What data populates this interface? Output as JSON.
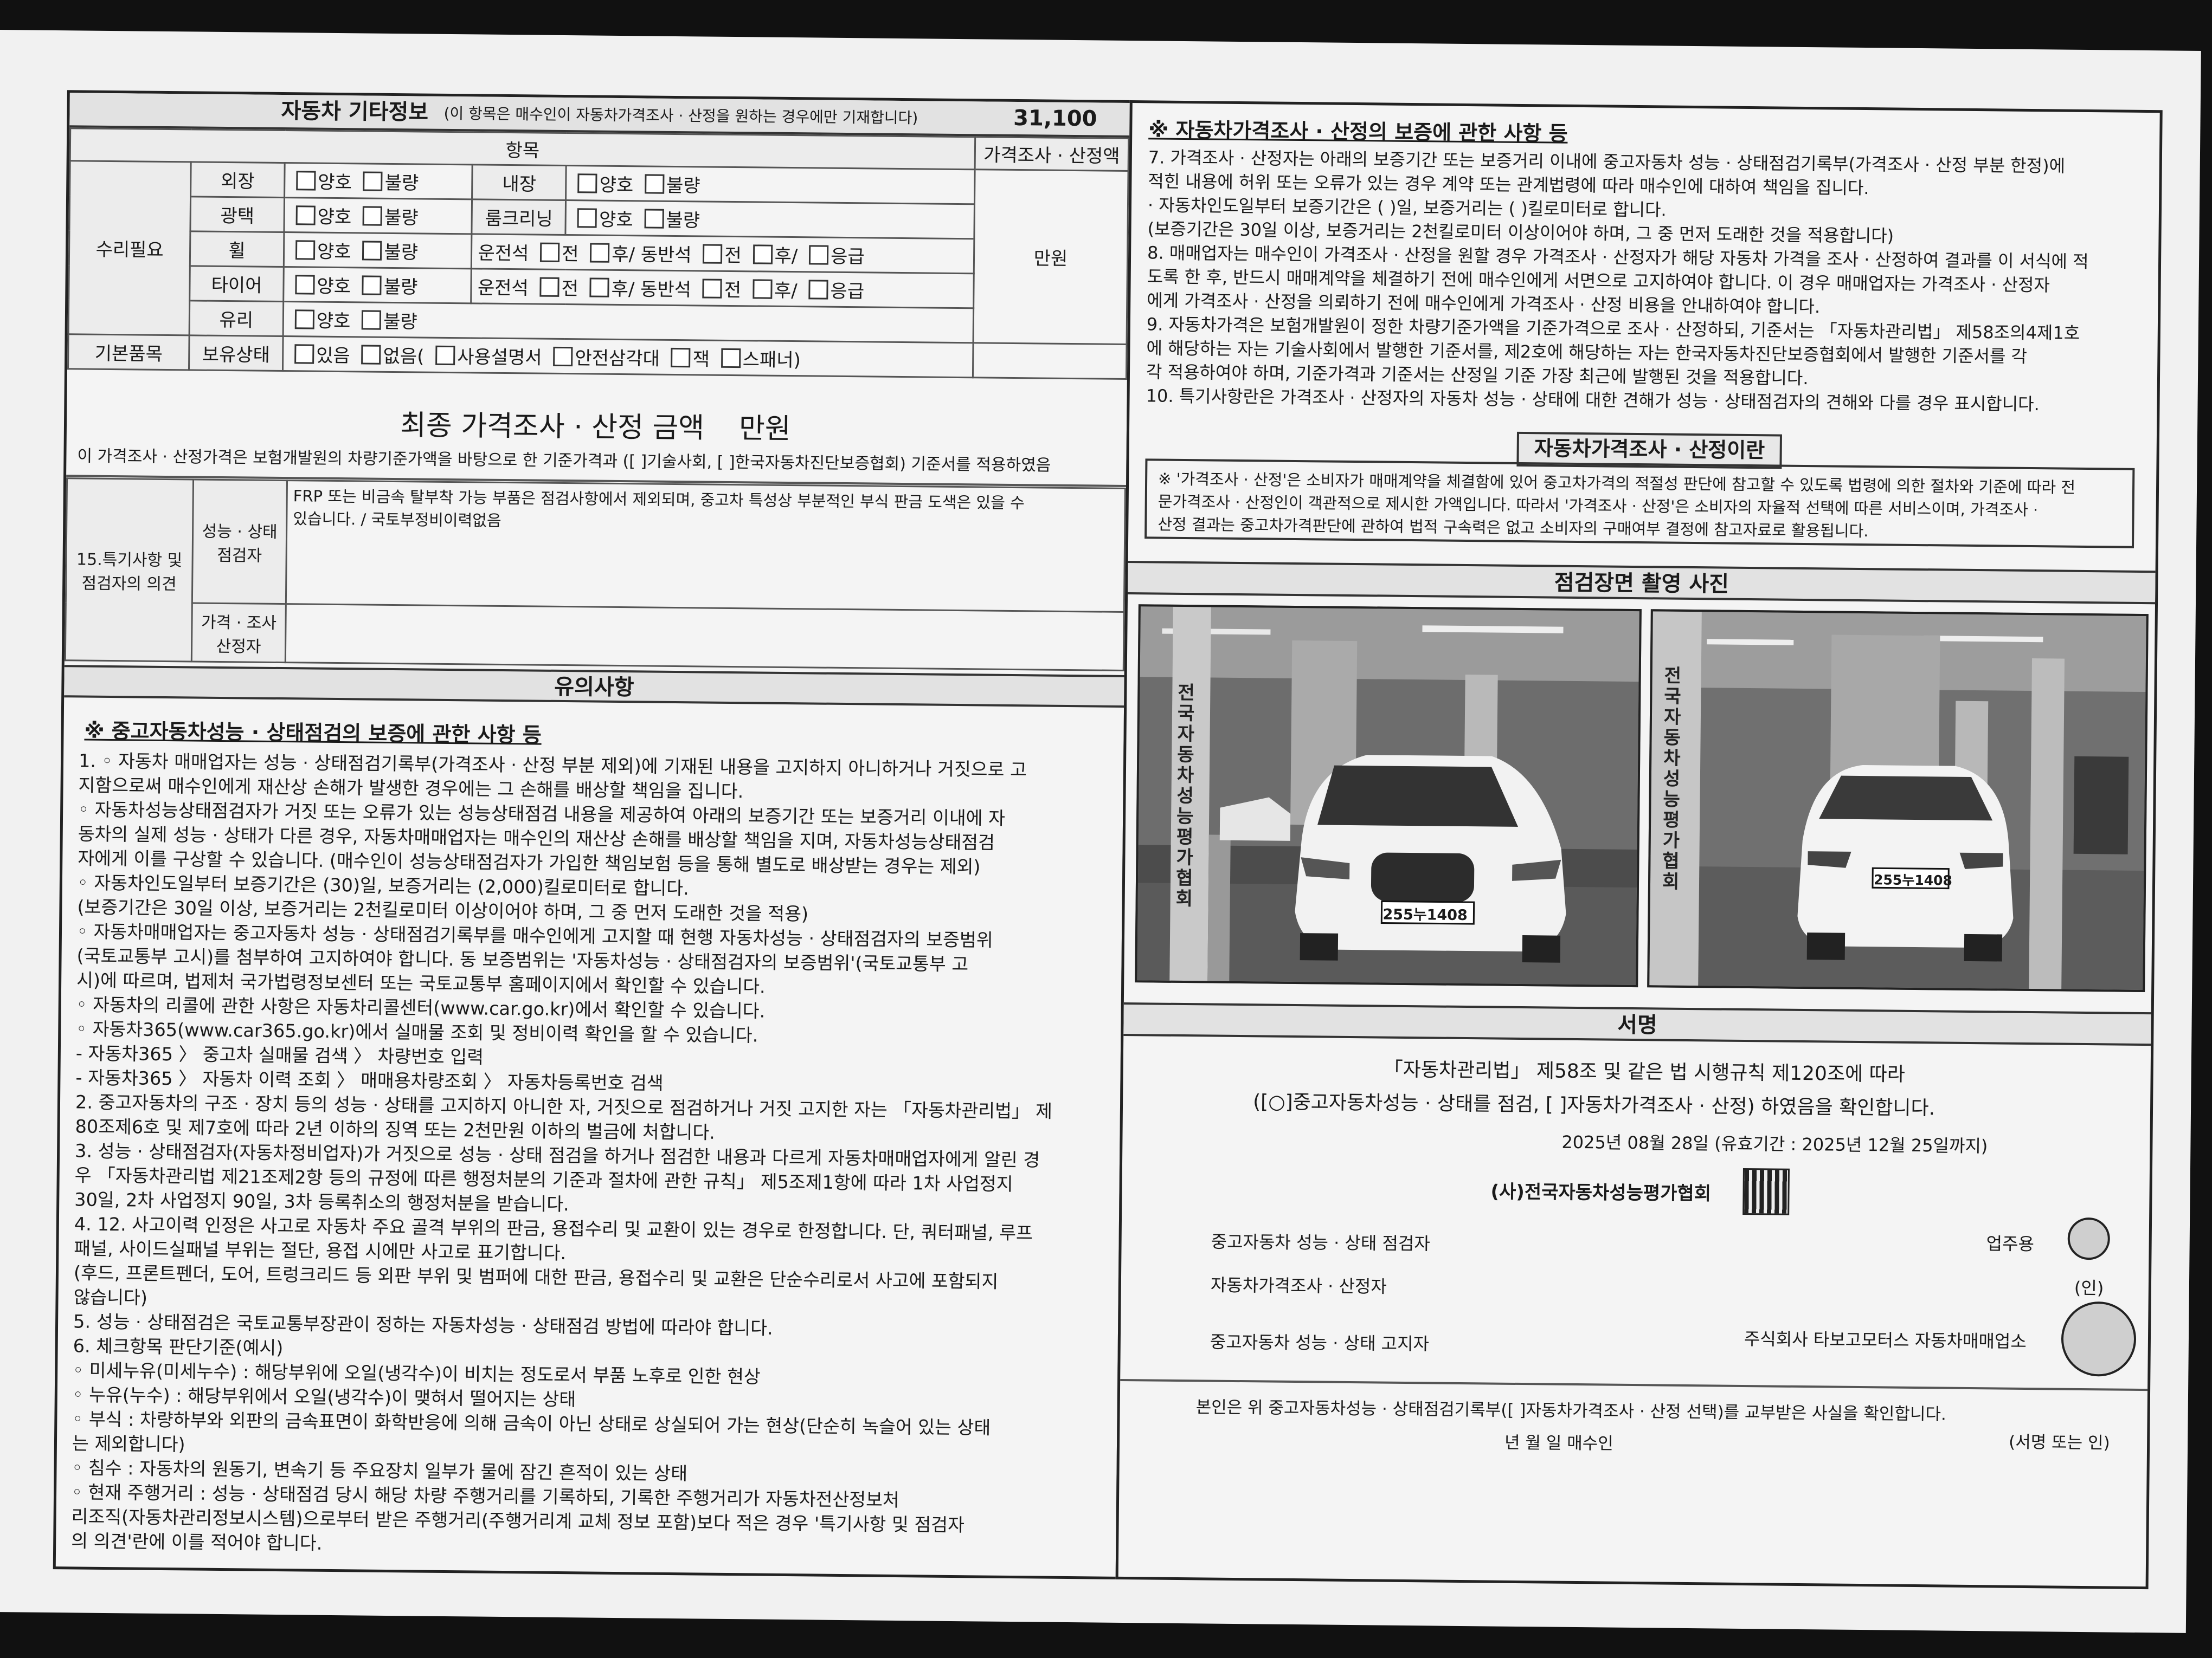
{
  "left": {
    "title": "자동차 기타정보",
    "title_note": "(이 항목은 매수인이 자동차가격조사 · 산정을 원하는 경우에만 기재합니다)",
    "amount": "31,100",
    "col_item": "항목",
    "col_price": "가격조사 · 산정액",
    "repair_needed": "수리필요",
    "good": "양호",
    "bad": "불량",
    "exterior": "외장",
    "interior": "내장",
    "gloss": "광택",
    "room_cleaning": "룸크리닝",
    "wheel": "휠",
    "tire": "타이어",
    "glass": "유리",
    "driver_seat": "운전석",
    "passenger_seat": "동반석",
    "front": "전",
    "rear": "후/",
    "emergency": "응급",
    "basic_items": "기본품목",
    "possession": "보유상태",
    "have": "있음",
    "none": "없음(",
    "manual": "사용설명서",
    "triangle": "안전삼각대",
    "jack": "잭",
    "spanner": "스패너)",
    "unit_manwon": "만원",
    "final_title": "최종 가격조사 · 산정 금액",
    "final_unit": "만원",
    "final_note": "이 가격조사 · 산정가격은 보험개발원의 차량기준가액을 바탕으로 한 기준가격과 ([   ]기술사회, [   ]한국자동차진단보증협회) 기준서를 적용하였음",
    "special_label": "15.특기사항 및 점검자의 의견",
    "inspector_label": "성능 · 상태 점검자",
    "inspector_text_1": "FRP 또는 비금속 탈부착 가능 부품은 점검사항에서 제외되며, 중고차 특성상 부분적인 부식 판금 도색은 있을 수",
    "inspector_text_2": "있습니다. / 국토부정비이력없음",
    "price_inspector_label": "가격 · 조사 산정자",
    "notice_title": "유의사항",
    "warranty_heading": "※ 중고자동차성능 · 상태점검의 보증에 관한 사항 등",
    "lines": [
      "1. ◦  자동차 매매업자는 성능 · 상태점검기록부(가격조사 · 산정 부분 제외)에 기재된 내용을 고지하지 아니하거나 거짓으로 고",
      "         지함으로써 매수인에게 재산상 손해가 발생한 경우에는 그 손해를 배상할 책임을 집니다.",
      "      ◦  자동차성능상태점검자가 거짓 또는 오류가 있는 성능상태점검 내용을 제공하여 아래의 보증기간 또는 보증거리 이내에 자",
      "         동차의 실제 성능 · 상태가 다른 경우, 자동차매매업자는 매수인의 재산상 손해를 배상할 책임을 지며, 자동차성능상태점검",
      "         자에게 이를 구상할 수 있습니다. (매수인이 성능상태점검자가 가입한 책임보험 등을 통해 별도로 배상받는 경우는 제외)",
      "      ◦  자동차인도일부터 보증기간은 (30)일, 보증거리는 (2,000)킬로미터로 합니다.",
      "         (보증기간은 30일 이상, 보증거리는 2천킬로미터 이상이어야 하며, 그 중 먼저 도래한 것을 적용)",
      "      ◦  자동차매매업자는 중고자동차 성능 · 상태점검기록부를 매수인에게 고지할 때 현행 자동차성능 · 상태점검자의 보증범위",
      "         (국토교통부 고시)를 첨부하여 고지하여야 합니다. 동 보증범위는 '자동차성능 · 상태점검자의 보증범위'(국토교통부 고",
      "         시)에 따르며, 법제처 국가법령정보센터 또는 국토교통부 홈페이지에서 확인할 수 있습니다.",
      "      ◦  자동차의 리콜에 관한 사항은 자동차리콜센터(www.car.go.kr)에서 확인할 수 있습니다.",
      "      ◦  자동차365(www.car365.go.kr)에서 실매물 조회 및 정비이력 확인을 할 수 있습니다.",
      "         - 자동차365 〉 중고차 실매물 검색 〉 차량번호 입력",
      "         - 자동차365 〉 자동차 이력 조회 〉 매매용차량조회 〉 자동차등록번호 검색",
      "2. 중고자동차의 구조 · 장치 등의 성능 · 상태를 고지하지 아니한 자, 거짓으로 점검하거나 거짓 고지한 자는 「자동차관리법」 제",
      "    80조제6호 및 제7호에 따라 2년 이하의 징역 또는 2천만원 이하의 벌금에 처합니다.",
      "3. 성능 · 상태점검자(자동차정비업자)가 거짓으로 성능 · 상태 점검을 하거나 점검한 내용과 다르게 자동차매매업자에게 알린 경",
      "    우 「자동차관리법 제21조제2항 등의 규정에 따른 행정처분의 기준과 절차에 관한 규칙」 제5조제1항에 따라 1차 사업정지",
      "    30일, 2차 사업정지 90일, 3차 등록취소의 행정처분을 받습니다.",
      "4. 12. 사고이력 인정은 사고로 자동차 주요 골격 부위의 판금, 용접수리 및 교환이 있는 경우로 한정합니다. 단, 쿼터패널, 루프",
      "    패널, 사이드실패널 부위는 절단, 용접 시에만 사고로 표기합니다.",
      "    (후드, 프론트펜더, 도어, 트렁크리드 등 외판 부위 및 범퍼에 대한 판금, 용접수리 및 교환은 단순수리로서 사고에 포함되지",
      "    않습니다)",
      "5. 성능 · 상태점검은 국토교통부장관이 정하는 자동차성능 · 상태점검 방법에 따라야 합니다.",
      "6. 체크항목 판단기준(예시)",
      "      ◦  미세누유(미세누수) : 해당부위에 오일(냉각수)이 비치는 정도로서 부품 노후로 인한 현상",
      "      ◦  누유(누수) : 해당부위에서 오일(냉각수)이 맺혀서 떨어지는 상태",
      "      ◦  부식 : 차량하부와 외판의 금속표면이 화학반응에 의해 금속이 아닌 상태로 상실되어 가는 현상(단순히 녹슬어 있는 상태",
      "         는 제외합니다)",
      "      ◦  침수 : 자동차의 원동기, 변속기 등 주요장치 일부가 물에 잠긴 흔적이 있는 상태",
      "      ◦  현재 주행거리 : 성능 · 상태점검 당시 해당 차량 주행거리를 기록하되, 기록한 주행거리가 자동차전산정보처",
      "         리조직(자동차관리정보시스템)으로부터 받은 주행거리(주행거리계 교체 정보 포함)보다 적은 경우 '특기사항 및 점검자",
      "         의 의견'란에 이를 적어야 합니다."
    ]
  },
  "right": {
    "heading": "※ 자동차가격조사 · 산정의 보증에 관한 사항 등",
    "lines": [
      "7. 가격조사 · 산정자는 아래의 보증기간 또는 보증거리 이내에 중고자동차 성능 · 상태점검기록부(가격조사 · 산정 부분 한정)에",
      "    적힌 내용에 허위 또는 오류가 있는 경우 계약 또는 관계법령에 따라 매수인에 대하여 책임을 집니다.",
      "    · 자동차인도일부터 보증기간은 ( )일, 보증거리는 ( )킬로미터로 합니다.",
      "    (보증기간은 30일 이상, 보증거리는 2천킬로미터 이상이어야 하며, 그 중 먼저 도래한 것을 적용합니다)",
      "8. 매매업자는 매수인이 가격조사 · 산정을 원할 경우 가격조사 · 산정자가 해당 자동차 가격을 조사 · 산정하여 결과를 이 서식에 적",
      "    도록 한 후, 반드시 매매계약을 체결하기 전에 매수인에게 서면으로 고지하여야 합니다. 이 경우 매매업자는 가격조사 · 산정자",
      "    에게 가격조사 · 산정을 의뢰하기 전에 매수인에게 가격조사 · 산정 비용을 안내하여야 합니다.",
      "9. 자동차가격은 보험개발원이 정한 차량기준가액을 기준가격으로 조사 · 산정하되, 기준서는 「자동차관리법」 제58조의4제1호",
      "    에 해당하는 자는 기술사회에서 발행한 기준서를, 제2호에 해당하는 자는 한국자동차진단보증협회에서 발행한 기준서를 각",
      "    각 적용하여야 하며, 기준가격과 기준서는 산정일 기준 가장 최근에 발행된 것을 적용합니다.",
      "10. 특기사항란은 가격조사 · 산정자의 자동차 성능 · 상태에 대한 견해가 성능 · 상태점검자의 견해와 다를 경우 표시합니다."
    ],
    "box_title": "자동차가격조사 · 산정이란",
    "box_lines": [
      "※ '가격조사 · 산정'은 소비자가 매매계약을 체결함에 있어 중고차가격의 적절성 판단에 참고할 수 있도록 법령에 의한 절차와 기준에 따라 전",
      "   문가격조사 · 산정인이 객관적으로 제시한 가액입니다. 따라서 '가격조사 · 산정'은 소비자의 자율적 선택에 따른 서비스이며, 가격조사 ·",
      "   산정 결과는 중고차가격판단에 관하여 법적 구속력은 없고 소비자의 구매여부 결정에 참고자료로 활용됩니다."
    ],
    "photo_title": "점검장면 촬영 사진",
    "plate_1": "255누1408",
    "plate_2": "255누1408",
    "pole_text_1": "전국자동차성능평가협회",
    "pole_text_2": "전국자동차성능평가협회",
    "sign_title": "서명",
    "sign_line_1": "「자동차관리법」 제58조 및 같은 법 시행규칙 제120조에 따라",
    "sign_line_2": "([○]중고자동차성능 · 상태를 점검, [      ]자동차가격조사 · 산정) 하였음을 확인합니다.",
    "date_line": "2025년 08월 28일 (유효기간 : 2025년 12월 25일까지)",
    "association": "(사)전국자동차성능평가협회",
    "inspector": "중고자동차 성능 · 상태 점검자",
    "price_assessor": "자동차가격조사 · 산정자",
    "notifier": "중고자동차 성능 · 상태 고지자",
    "business_use": "업주용",
    "seal_label": "(인)",
    "dealer": "주식회사 타보고모터스 자동차매매업소",
    "receipt": "본인은 위 중고자동차성능 · 상태점검기록부([   ]자동차가격조사 · 산정 선택)를 교부받은 사실을 확인합니다.",
    "ymd_buyer": "년        월        일        매수인",
    "sign_or_seal": "(서명 또는 인)"
  }
}
